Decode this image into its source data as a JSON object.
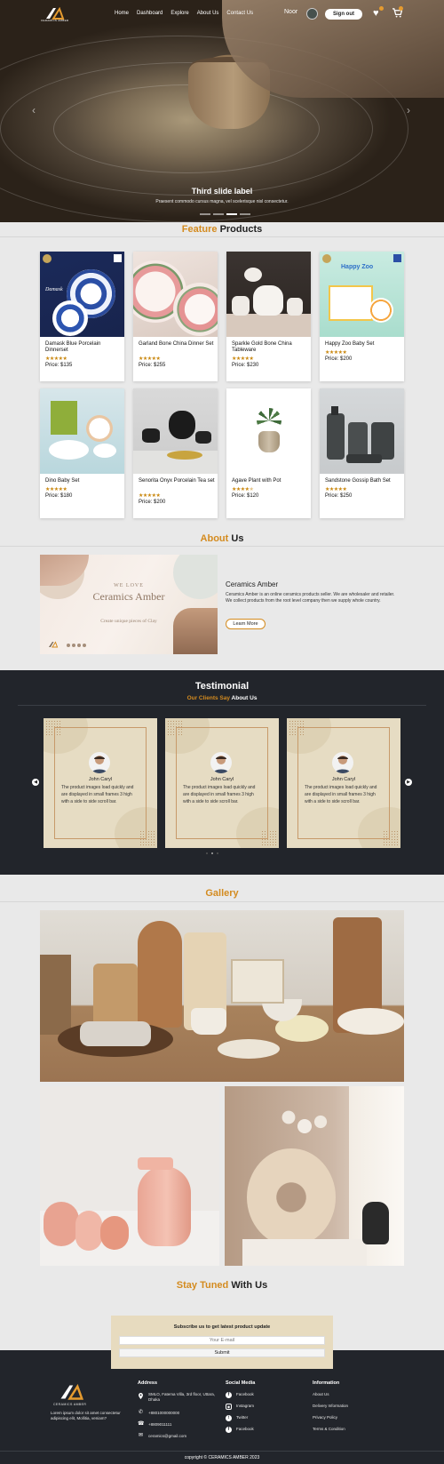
{
  "nav": {
    "brand": "CERAMICS AMBER",
    "links": [
      "Home",
      "Dashboard",
      "Explore",
      "About Us",
      "Contact Us"
    ],
    "user": "Noor",
    "signout": "Sign out"
  },
  "hero": {
    "title": "Third slide label",
    "text": "Praesent commodo cursus magna, vel scelerisque nisl consectetur.",
    "prev": "‹",
    "next": "›"
  },
  "featured": {
    "title_accent": "Feature",
    "title_rest": "Products",
    "products": [
      {
        "name": "Damask Blue Porcelain Dinnerset",
        "rating": 5,
        "price": "Price: $135"
      },
      {
        "name": "Garland Bone China Dinner Set",
        "rating": 5,
        "price": "Price: $255"
      },
      {
        "name": "Sparkle Gold Bone China Tableware",
        "rating": 5,
        "price": "Price: $230"
      },
      {
        "name": "Happy Zoo Baby Set",
        "rating": 5,
        "price": "Price: $200"
      },
      {
        "name": "Dino Baby Set",
        "rating": 5,
        "price": "Price: $180"
      },
      {
        "name": "Senorita Onyx Porcelain Tea set",
        "rating": 5,
        "price": "Price: $200"
      },
      {
        "name": "Agave Plant with Pot",
        "rating": 4.5,
        "price": "Price: $120"
      },
      {
        "name": "Sandstone Gossip Bath Set",
        "rating": 5,
        "price": "Price: $250"
      }
    ],
    "image_texts": {
      "damask": "Damask",
      "zoo": "Happy Zoo"
    }
  },
  "about": {
    "title_accent": "About",
    "title_rest": "Us",
    "image_small": "WE LOVE",
    "image_big": "Ceramics Amber",
    "image_tagline": "Create unique pieces of Clay",
    "heading": "Ceramics Amber",
    "text": "Ceramics Amber is an online ceramics products seller. We are wholesaler and retailer. We collect products from the root level company then we supply whole country.",
    "button": "Learn More"
  },
  "testimonial": {
    "title": "Testimonial",
    "sub_accent": "Our Clients Say",
    "sub_rest": "About Us",
    "cards": [
      {
        "name": "John Caryl",
        "text": "The product images load quickly and are displayed in small frames 3 high with a side to side scroll bar."
      },
      {
        "name": "John Caryl",
        "text": "The product images load quickly and are displayed in small frames 3 high with a side to side scroll bar."
      },
      {
        "name": "John Caryl",
        "text": "The product images load quickly and are displayed in small frames 3 high with a side to side scroll bar."
      }
    ]
  },
  "gallery": {
    "title": "Gallery"
  },
  "stay": {
    "title_accent": "Stay Tuned",
    "title_rest": "With Us",
    "sub_title": "Subscribe us to get latest product update",
    "email_placeholder": "Your E-mail",
    "submit": "Submit"
  },
  "footer": {
    "brand": "CERAMICS AMBER",
    "about_text": "Lorem ipsum dolor sit amet consectetur adipiscing elit, Mollitia, veniam?",
    "address_title": "Address",
    "address": "SMLO, Fatema Villa, 3rd floor, Uttara, Dhaka",
    "phone1": "+8801000000000",
    "phone2": "+8809011111",
    "email": "ceramics@gmail.com",
    "social_title": "Social Media",
    "social": [
      "Facebook",
      "Instagram",
      "Twitter",
      "Facebook"
    ],
    "info_title": "Information",
    "info": [
      "About Us",
      "Delivery Information",
      "Privacy Policy",
      "Terms & Condition"
    ],
    "copyright": "copyright © CERAMICS AMBER 2023"
  },
  "colors": {
    "accent": "#d48b1f",
    "dark": "#22252b",
    "background": "#e9e9e9"
  }
}
